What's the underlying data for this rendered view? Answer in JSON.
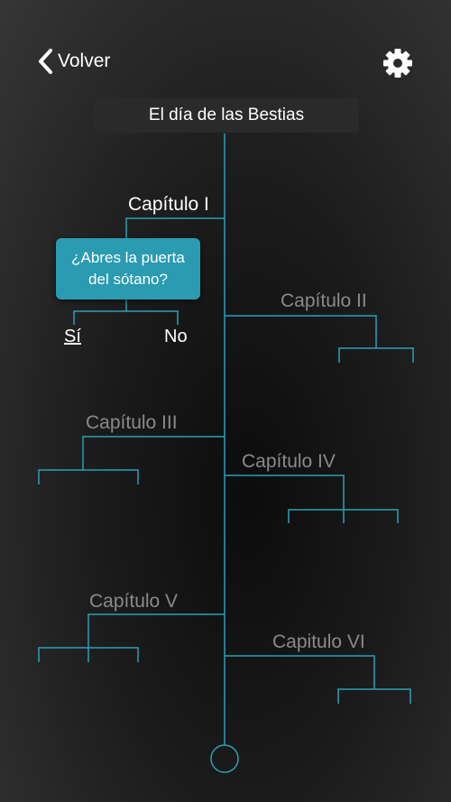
{
  "nav": {
    "back_label": "Volver",
    "back_icon": "chevron-left-icon",
    "settings_icon": "gear-icon"
  },
  "story": {
    "title": "El día de las Bestias"
  },
  "chapters": [
    {
      "label": "Capítulo I",
      "state": "current"
    },
    {
      "label": "Capítulo II",
      "state": "locked"
    },
    {
      "label": "Capítulo III",
      "state": "locked"
    },
    {
      "label": "Capítulo IV",
      "state": "locked"
    },
    {
      "label": "Capítulo V",
      "state": "locked"
    },
    {
      "label": "Capitulo VI",
      "state": "locked"
    }
  ],
  "question": {
    "text": "¿Abres la puerta del sótano?",
    "choices": [
      {
        "label": "Sí",
        "selected": true
      },
      {
        "label": "No",
        "selected": false
      }
    ]
  },
  "colors": {
    "line": "#2aa0b8",
    "question_bg": "#2a9bb1",
    "locked_text": "#8a8a8a",
    "title_bg": "#2a2a2a"
  }
}
